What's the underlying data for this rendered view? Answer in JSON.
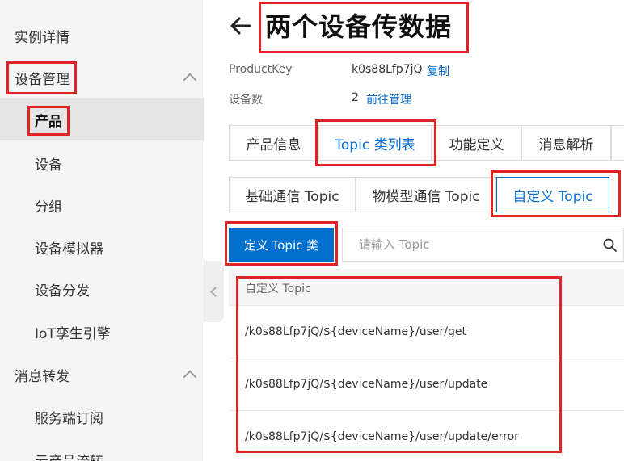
{
  "sidebar": {
    "items": [
      {
        "label": "实例详情"
      },
      {
        "label": "设备管理"
      },
      {
        "label": "产品"
      },
      {
        "label": "设备"
      },
      {
        "label": "分组"
      },
      {
        "label": "设备模拟器"
      },
      {
        "label": "设备分发"
      },
      {
        "label": "IoT孪生引擎"
      },
      {
        "label": "消息转发"
      },
      {
        "label": "服务端订阅"
      },
      {
        "label": "云产品流转"
      }
    ]
  },
  "header": {
    "title": "两个设备传数据",
    "product_key_label": "ProductKey",
    "product_key_value": "k0s88Lfp7jQ",
    "copy_label": "复制",
    "device_count_label": "设备数",
    "device_count_value": "2",
    "manage_link": "前往管理"
  },
  "tabs": [
    "产品信息",
    "Topic 类列表",
    "功能定义",
    "消息解析"
  ],
  "subtabs": [
    "基础通信 Topic",
    "物模型通信 Topic",
    "自定义 Topic"
  ],
  "toolbar": {
    "define_button": "定义 Topic 类",
    "search_placeholder": "请输入 Topic"
  },
  "table": {
    "header": "自定义 Topic",
    "rows": [
      "/k0s88Lfp7jQ/${deviceName}/user/get",
      "/k0s88Lfp7jQ/${deviceName}/user/update",
      "/k0s88Lfp7jQ/${deviceName}/user/update/error"
    ]
  },
  "colors": {
    "accent": "#0a6ed1",
    "primary_button": "#0070cc",
    "highlight": "#e02424"
  }
}
